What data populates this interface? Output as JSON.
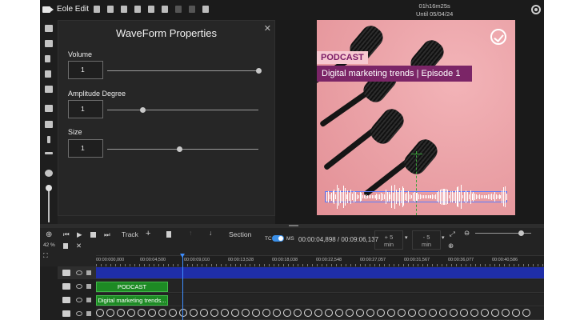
{
  "app": {
    "name": "Eole Edit"
  },
  "timer": {
    "remaining": "01h16m25s",
    "until": "Until 05/04/24"
  },
  "properties": {
    "title": "WaveForm Properties",
    "close": "✕",
    "volume": {
      "label": "Volume",
      "value": "1",
      "slider": 1.0
    },
    "amplitude": {
      "label": "Amplitude Degree",
      "value": "1",
      "slider": 0.22
    },
    "size": {
      "label": "Size",
      "value": "1",
      "slider": 0.47
    }
  },
  "canvas": {
    "badge": "PODCAST",
    "episode_title": "Digital marketing trends | Episode 1"
  },
  "controls": {
    "track_label": "Track",
    "section_label": "Section",
    "tc_label": "TC",
    "ms_label": "MS",
    "time": "00:00:04,898 / 00:09:06,137",
    "step_forward": "+ 5\nmin",
    "step_back": "- 5\nmin",
    "zoom_percent": "42 %"
  },
  "ruler": {
    "ticks": [
      "00:00:000,000",
      "00:00:04,500",
      "00:00:09,010",
      "00:00:13,528",
      "00:00:18,038",
      "00:00:22,548",
      "00:00:27,057",
      "00:00:31,567",
      "00:00:36,077",
      "00:00:40,586"
    ]
  },
  "tracks": {
    "podcast_clip": "PODCAST",
    "title_clip": "Digital marketing trends..."
  },
  "colors": {
    "accent": "#3a8ee6",
    "clip_green": "#1d8a24",
    "clip_blue": "#1f2ea8",
    "title_bg": "#7b2567"
  }
}
